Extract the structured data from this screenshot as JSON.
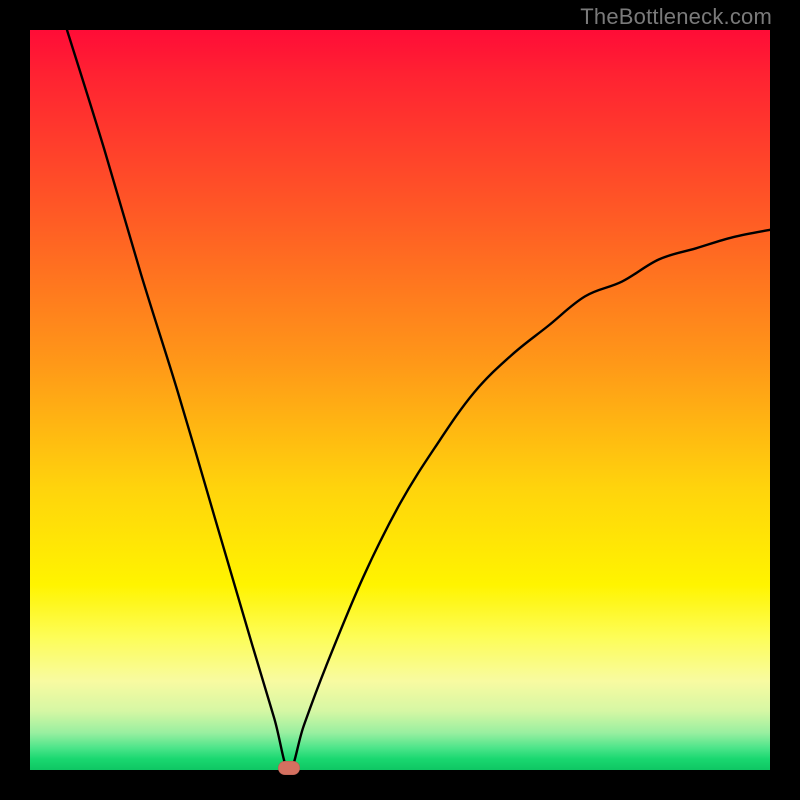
{
  "attribution": "TheBottleneck.com",
  "colors": {
    "frame": "#000000",
    "curve_stroke": "#000000",
    "marker": "#d47060",
    "gradient_top": "#ff0c37",
    "gradient_mid": "#fff400",
    "gradient_bottom": "#0fc663"
  },
  "chart_data": {
    "type": "line",
    "title": "",
    "xlabel": "",
    "ylabel": "",
    "xlim": [
      0,
      100
    ],
    "ylim": [
      0,
      100
    ],
    "grid": false,
    "legend": false,
    "notes": "V-shaped bottleneck curve over vertical heat gradient (red→yellow→green). Minimum ≈ (35, 0). Left branch starts at top-left corner; right branch ends near upper-right at ~y=73. No axis tick labels shown.",
    "series": [
      {
        "name": "bottleneck-curve",
        "x": [
          5,
          10,
          15,
          20,
          25,
          30,
          33,
          35,
          37,
          40,
          45,
          50,
          55,
          60,
          65,
          70,
          75,
          80,
          85,
          90,
          95,
          100
        ],
        "y": [
          100,
          84,
          67,
          51,
          34,
          17,
          7,
          0,
          6,
          14,
          26,
          36,
          44,
          51,
          56,
          60,
          64,
          66,
          69,
          70.5,
          72,
          73
        ]
      }
    ],
    "annotations": [
      {
        "type": "marker",
        "shape": "pill",
        "x": 35,
        "y": 0
      }
    ]
  }
}
